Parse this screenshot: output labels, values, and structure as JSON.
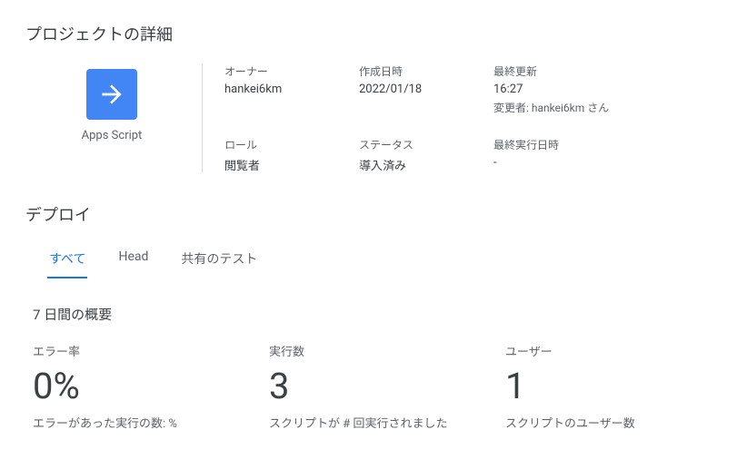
{
  "sections": {
    "details_title": "プロジェクトの詳細",
    "deploy_title": "デプロイ",
    "summary_title": "7 日間の概要"
  },
  "app": {
    "label": "Apps Script",
    "icon": "arrow-right-icon"
  },
  "details": {
    "owner_label": "オーナー",
    "owner_value": "hankei6km",
    "created_label": "作成日時",
    "created_value": "2022/01/18",
    "updated_label": "最終更新",
    "updated_value": "16:27",
    "updated_by": "変更者: hankei6km さん",
    "role_label": "ロール",
    "role_value": "閲覧者",
    "status_label": "ステータス",
    "status_value": "導入済み",
    "lastrun_label": "最終実行日時",
    "lastrun_value": "-"
  },
  "tabs": [
    {
      "label": "すべて",
      "active": true
    },
    {
      "label": "Head",
      "active": false
    },
    {
      "label": "共有のテスト",
      "active": false
    }
  ],
  "stats": [
    {
      "label": "エラー率",
      "value": "0%",
      "desc": "エラーがあった実行の数: %"
    },
    {
      "label": "実行数",
      "value": "3",
      "desc": "スクリプトが # 回実行されました"
    },
    {
      "label": "ユーザー",
      "value": "1",
      "desc": "スクリプトのユーザー数"
    }
  ]
}
